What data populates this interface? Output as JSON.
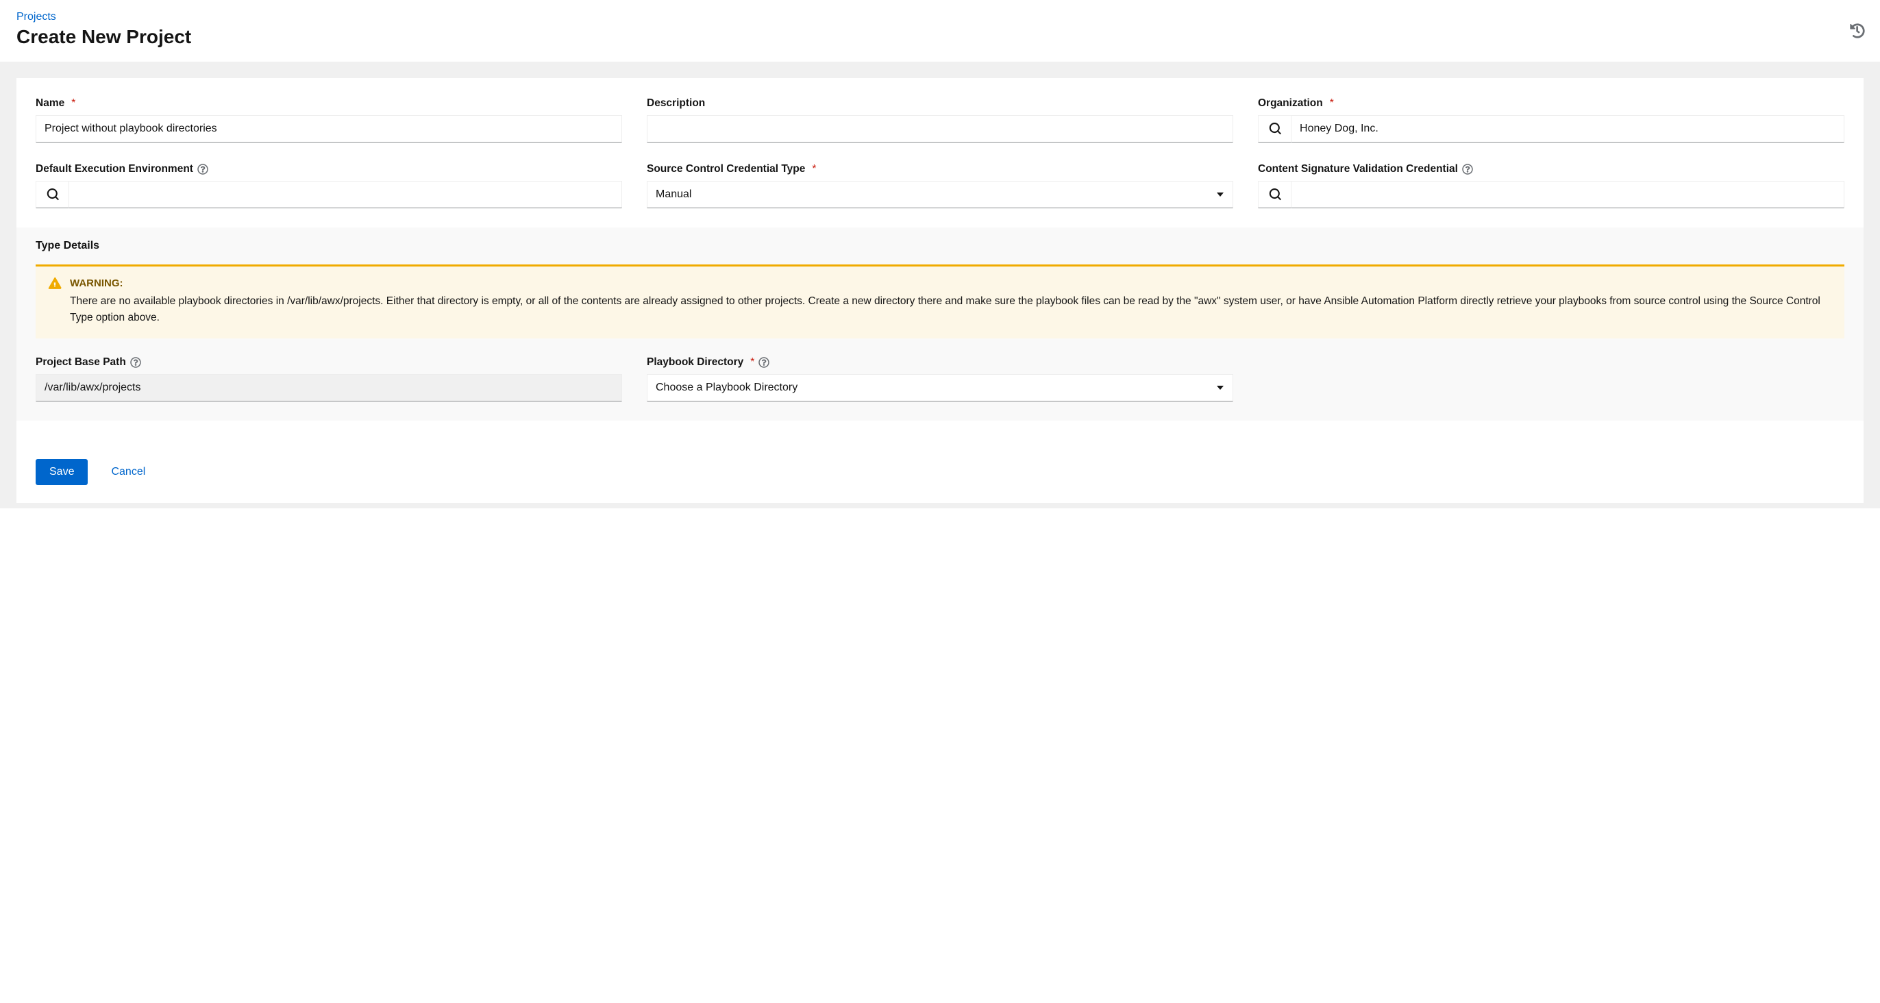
{
  "breadcrumb": {
    "projects": "Projects"
  },
  "page": {
    "title": "Create New Project"
  },
  "form": {
    "name": {
      "label": "Name",
      "value": "Project without playbook directories"
    },
    "description": {
      "label": "Description",
      "value": ""
    },
    "organization": {
      "label": "Organization",
      "value": "Honey Dog, Inc."
    },
    "default_ee": {
      "label": "Default Execution Environment",
      "value": ""
    },
    "scm_cred_type": {
      "label": "Source Control Credential Type",
      "value": "Manual"
    },
    "content_sig_cred": {
      "label": "Content Signature Validation Credential",
      "value": ""
    }
  },
  "details": {
    "title": "Type Details",
    "alert": {
      "title": "WARNING:",
      "text": "There are no available playbook directories in /var/lib/awx/projects. Either that directory is empty, or all of the contents are already assigned to other projects. Create a new directory there and make sure the playbook files can be read by the \"awx\" system user, or have Ansible Automation Platform directly retrieve your playbooks from source control using the Source Control Type option above."
    },
    "base_path": {
      "label": "Project Base Path",
      "value": "/var/lib/awx/projects"
    },
    "playbook_dir": {
      "label": "Playbook Directory",
      "placeholder": "Choose a Playbook Directory"
    }
  },
  "actions": {
    "save": "Save",
    "cancel": "Cancel"
  }
}
